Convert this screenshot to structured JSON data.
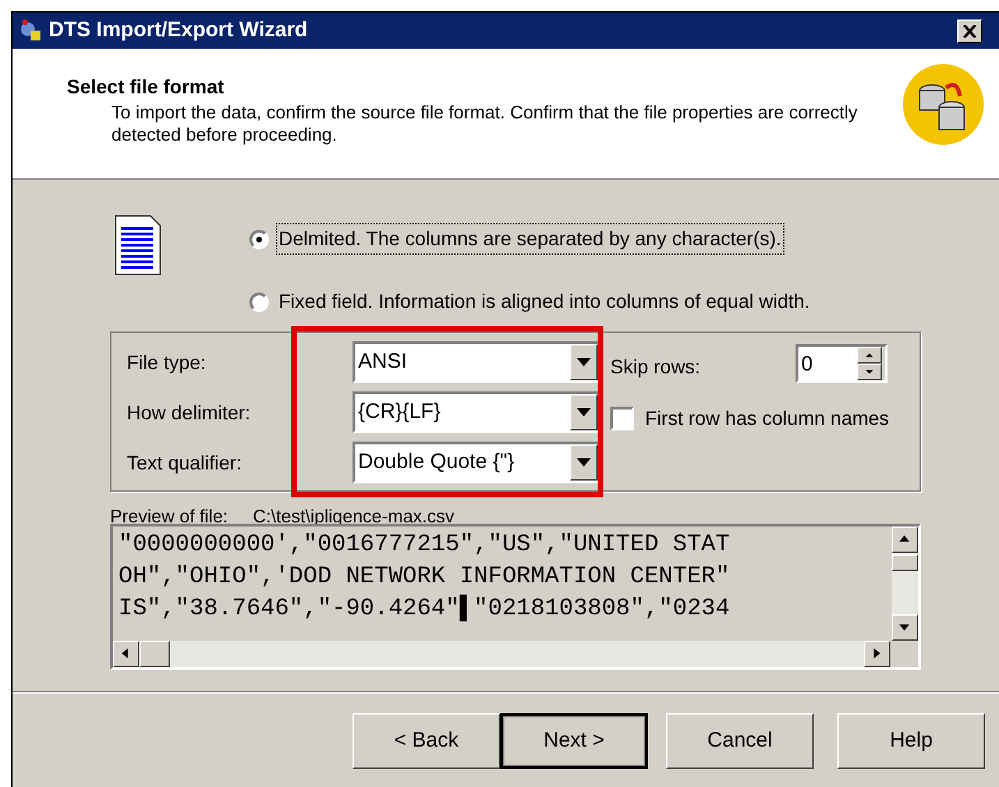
{
  "window": {
    "title": "DTS Import/Export Wizard"
  },
  "header": {
    "title": "Select file format",
    "description": "To import the data, confirm the source file format.  Confirm that the file properties are correctly detected before proceeding."
  },
  "format_options": [
    {
      "label": "Delmited.  The columns are separated by any character(s).",
      "selected": true,
      "focused": true
    },
    {
      "label": "Fixed field.  Information is aligned into columns of equal width.",
      "selected": false,
      "focused": false
    }
  ],
  "fields": [
    {
      "label": "File type:",
      "value": "ANSI"
    },
    {
      "label": "How delimiter:",
      "value": "{CR}{LF}"
    },
    {
      "label": "Text qualifier:",
      "value": "Double Quote {\"}"
    }
  ],
  "skip_rows": {
    "label": "Skip rows:",
    "value": "0"
  },
  "first_row_names": {
    "label": "First row has column names",
    "checked": false
  },
  "preview": {
    "label": "Preview of file:",
    "path": "C:\\test\\ipligence-max.csv",
    "lines": [
      "\"0000000000',\"0016777215\",\"US\",\"UNITED STAT",
      "OH\",\"OHIO\",'DOD NETWORK INFORMATION CENTER\"",
      "IS\",\"38.7646\",\"-90.4264\"▌\"0218103808\",\"0234"
    ]
  },
  "buttons": [
    {
      "label": "< Back",
      "default": false
    },
    {
      "label": "Next >",
      "default": true
    },
    {
      "label": "Cancel",
      "default": false
    },
    {
      "label": "Help",
      "default": false
    }
  ]
}
